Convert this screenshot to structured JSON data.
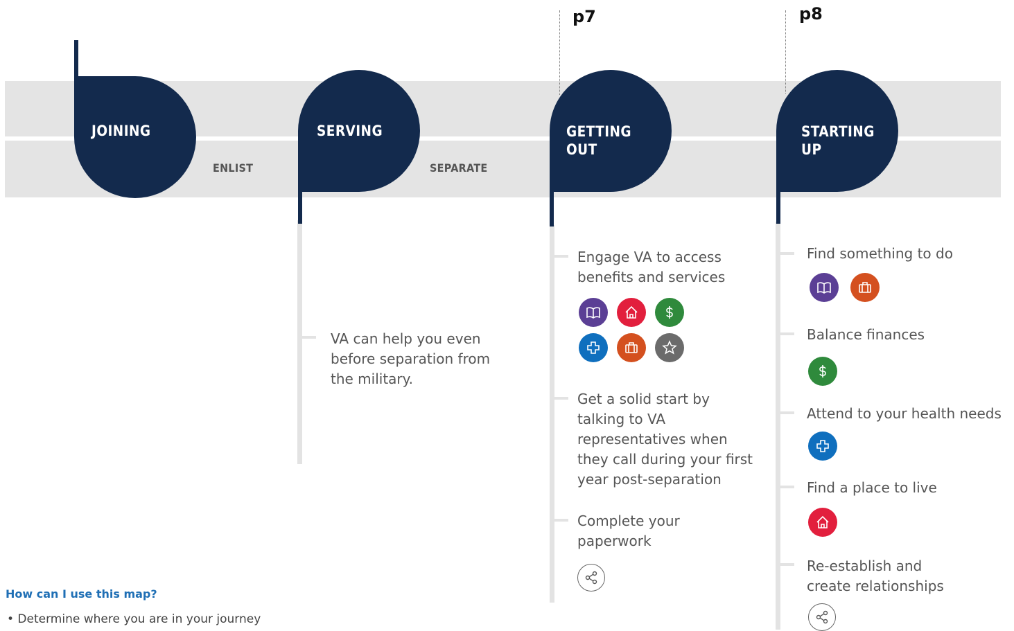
{
  "page_refs": {
    "getting_out": "p7",
    "starting_up": "p8"
  },
  "stages": {
    "joining": "JOINING",
    "serving": "SERVING",
    "getting_out": "GETTING\nOUT",
    "starting_up": "STARTING\nUP"
  },
  "connectors": {
    "enlist": "ENLIST",
    "separate": "SEPARATE"
  },
  "serving_steps": [
    "VA can help you even\nbefore separation from\nthe military."
  ],
  "getting_out_steps": [
    "Engage VA to access\nbenefits and services",
    "Get a solid start by\ntalking to VA\nrepresentatives when\nthey call during your first\nyear post-separation",
    "Complete your\npaperwork"
  ],
  "starting_up_steps": [
    "Find something to do",
    "Balance finances",
    "Attend to your health needs",
    "Find a place to live",
    "Re-establish and\ncreate relationships"
  ],
  "icons": {
    "education": {
      "name": "book-icon",
      "color": "#5b3f95"
    },
    "housing": {
      "name": "home-icon",
      "color": "#e21f3d"
    },
    "finance": {
      "name": "dollar-icon",
      "color": "#2f8a3c"
    },
    "health": {
      "name": "medical-cross-icon",
      "color": "#0f6fbe"
    },
    "employment": {
      "name": "briefcase-icon",
      "color": "#d4501f"
    },
    "recognition": {
      "name": "star-icon",
      "color": "#6b6b6b"
    },
    "social": {
      "name": "share-icon",
      "color": "#ffffff"
    }
  },
  "faq": {
    "title": "How can I use this map?",
    "items": [
      "• Determine where you are in your journey"
    ]
  }
}
